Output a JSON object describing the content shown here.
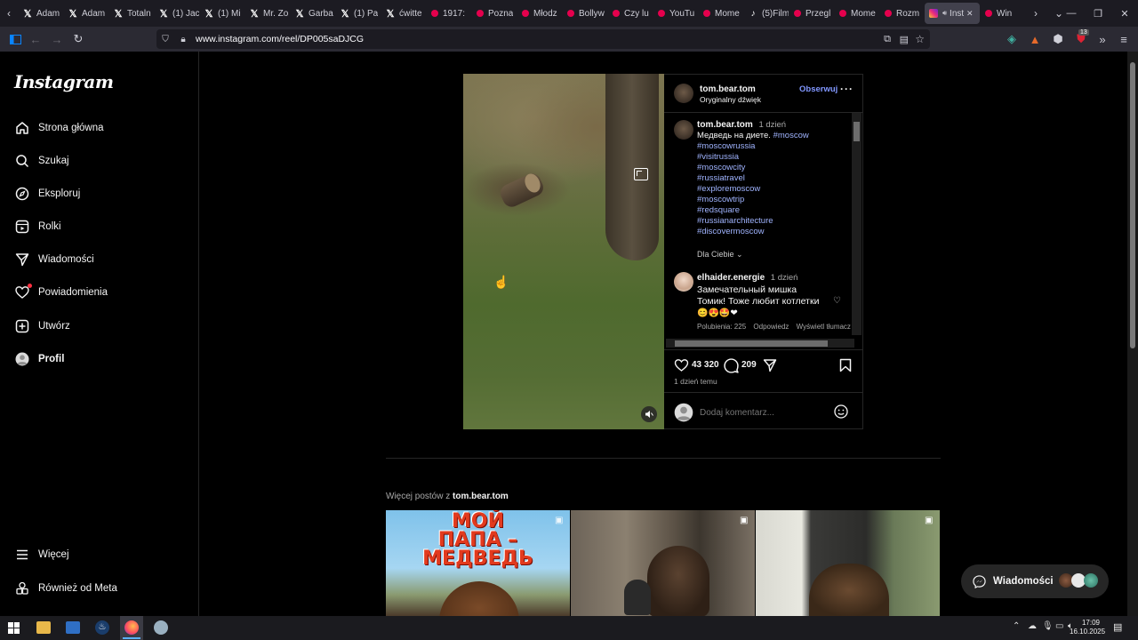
{
  "browser": {
    "tabs": [
      {
        "title": "Adam",
        "icon": "x"
      },
      {
        "title": "Adam",
        "icon": "x"
      },
      {
        "title": "Totaln",
        "icon": "x"
      },
      {
        "title": "(1) Jac",
        "icon": "x"
      },
      {
        "title": "(1) Mi",
        "icon": "x"
      },
      {
        "title": "Mr. Zo",
        "icon": "x"
      },
      {
        "title": "Garba",
        "icon": "x"
      },
      {
        "title": "(1) Pa",
        "icon": "x"
      },
      {
        "title": "ćwitte",
        "icon": "x"
      },
      {
        "title": "1917:",
        "icon": "yt"
      },
      {
        "title": "Pozna",
        "icon": "yt"
      },
      {
        "title": "Młodz",
        "icon": "yt"
      },
      {
        "title": "Bollyw",
        "icon": "yt"
      },
      {
        "title": "Czy lu",
        "icon": "yt"
      },
      {
        "title": "YouTu",
        "icon": "yt"
      },
      {
        "title": "Mome",
        "icon": "yt"
      },
      {
        "title": "(5)Film",
        "icon": "tiktok"
      },
      {
        "title": "Przegl",
        "icon": "yt"
      },
      {
        "title": "Mome",
        "icon": "yt"
      },
      {
        "title": "Rozm",
        "icon": "yt"
      },
      {
        "title": "Insta",
        "icon": "instagram",
        "active": true
      },
      {
        "title": "Win",
        "icon": "yt"
      }
    ],
    "url": "www.instagram.com/reel/DP005saDJCG",
    "extension_badge": "13"
  },
  "sidebar": {
    "logo": "Instagram",
    "items": [
      {
        "label": "Strona główna",
        "icon": "home-icon"
      },
      {
        "label": "Szukaj",
        "icon": "search-icon"
      },
      {
        "label": "Eksploruj",
        "icon": "compass-icon"
      },
      {
        "label": "Rolki",
        "icon": "reels-icon"
      },
      {
        "label": "Wiadomości",
        "icon": "messages-icon"
      },
      {
        "label": "Powiadomienia",
        "icon": "heart-icon"
      },
      {
        "label": "Utwórz",
        "icon": "plus-icon"
      },
      {
        "label": "Profil",
        "icon": "profile-icon"
      }
    ],
    "more_label": "Więcej",
    "meta_label": "Również od Meta"
  },
  "post": {
    "username": "tom.bear.tom",
    "audio": "Oryginalny dźwięk",
    "follow_label": "Obserwuj",
    "caption_user": "tom.bear.tom",
    "caption_time": "1 dzień",
    "caption_text": "Медведь на диете.",
    "hashtags": [
      "#moscow",
      "#moscowrussia",
      "#visitrussia",
      "#moscowcity",
      "#russiatravel",
      "#exploremoscow",
      "#moscowtrip",
      "#redsquare",
      "#russianarchitecture",
      "#discovermoscow"
    ],
    "sort_label": "Dla Ciebie",
    "comment": {
      "user": "elhaider.energie",
      "time": "1 dzień",
      "text_line1": "Замечательный мишка",
      "text_line2": "Томик! Тоже любит котлетки",
      "emojis": "😊😍🤩❤",
      "likes": "Polubienia: 225",
      "reply": "Odpowiedz",
      "translate": "Wyświetl tłumacz"
    },
    "like_count": "43 320",
    "comment_count": "209",
    "time_ago": "1 dzień temu",
    "comment_placeholder": "Dodaj komentarz..."
  },
  "more_posts": {
    "prefix": "Więcej postów z",
    "user": "tom.bear.tom",
    "movie_title_line1": "МОЙ",
    "movie_title_line2": "ПАПА –",
    "movie_title_line3": "МЕДВЕДЬ"
  },
  "messages_widget": {
    "label": "Wiadomości"
  },
  "taskbar": {
    "time": "17:09",
    "date": "16.10.2025"
  }
}
